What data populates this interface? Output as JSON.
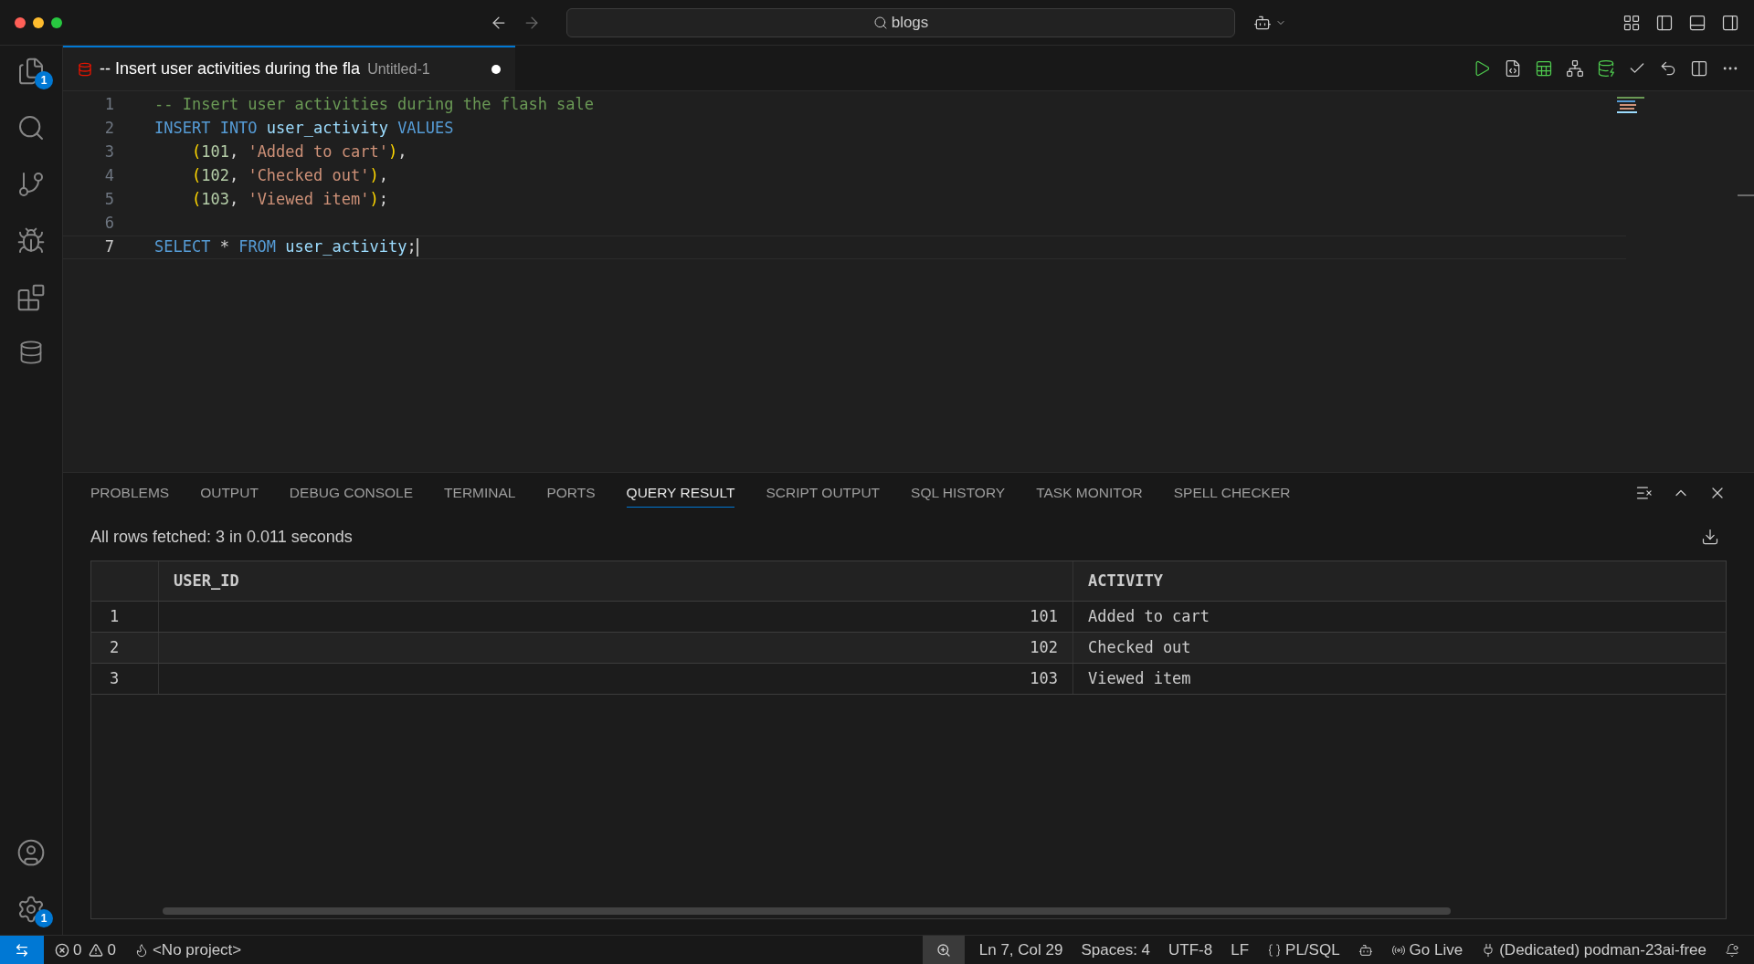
{
  "title_bar": {
    "search": "blogs"
  },
  "activity_bar": {
    "explorer_badge": "1",
    "settings_badge": "1"
  },
  "editor_tabs": [
    {
      "title": "-- Insert user activities during the fla",
      "description": "Untitled-1",
      "selected": true,
      "dirty": true
    }
  ],
  "code": [
    {
      "number": "1",
      "current": false,
      "indented": false,
      "tokens": [
        {
          "kind": "comment",
          "text": "-- Insert user activities during the flash sale"
        }
      ]
    },
    {
      "number": "2",
      "current": false,
      "indented": false,
      "tokens": [
        {
          "kind": "keyword",
          "text": "INSERT INTO "
        },
        {
          "kind": "ident",
          "text": "user_activity "
        },
        {
          "kind": "keyword",
          "text": "VALUES"
        }
      ]
    },
    {
      "number": "3",
      "current": false,
      "indented": true,
      "tokens": [
        {
          "kind": "bracket",
          "text": "("
        },
        {
          "kind": "number",
          "text": "101"
        },
        {
          "kind": "punct",
          "text": ", "
        },
        {
          "kind": "string",
          "text": "'Added to cart'"
        },
        {
          "kind": "bracket",
          "text": ")"
        },
        {
          "kind": "punct",
          "text": ","
        }
      ]
    },
    {
      "number": "4",
      "current": false,
      "indented": true,
      "tokens": [
        {
          "kind": "bracket",
          "text": "("
        },
        {
          "kind": "number",
          "text": "102"
        },
        {
          "kind": "punct",
          "text": ", "
        },
        {
          "kind": "string",
          "text": "'Checked out'"
        },
        {
          "kind": "bracket",
          "text": ")"
        },
        {
          "kind": "punct",
          "text": ","
        }
      ]
    },
    {
      "number": "5",
      "current": false,
      "indented": true,
      "tokens": [
        {
          "kind": "bracket",
          "text": "("
        },
        {
          "kind": "number",
          "text": "103"
        },
        {
          "kind": "punct",
          "text": ", "
        },
        {
          "kind": "string",
          "text": "'Viewed item'"
        },
        {
          "kind": "bracket",
          "text": ")"
        },
        {
          "kind": "punct",
          "text": ";"
        }
      ]
    },
    {
      "number": "6",
      "current": false
    },
    {
      "number": "7",
      "current": true,
      "indented": false,
      "tokens": [
        {
          "kind": "keyword",
          "text": "SELECT "
        },
        {
          "kind": "punct",
          "text": "* "
        },
        {
          "kind": "keyword",
          "text": "FROM "
        },
        {
          "kind": "ident",
          "text": "user_activity"
        },
        {
          "kind": "punct",
          "text": ";"
        }
      ]
    }
  ],
  "panel_tabs": [
    {
      "label": "PROBLEMS",
      "selected": false
    },
    {
      "label": "OUTPUT",
      "selected": false
    },
    {
      "label": "DEBUG CONSOLE",
      "selected": false
    },
    {
      "label": "TERMINAL",
      "selected": false
    },
    {
      "label": "PORTS",
      "selected": false
    },
    {
      "label": "QUERY RESULT",
      "selected": true
    },
    {
      "label": "SCRIPT OUTPUT",
      "selected": false
    },
    {
      "label": "SQL HISTORY",
      "selected": false
    },
    {
      "label": "TASK MONITOR",
      "selected": false
    },
    {
      "label": "SPELL CHECKER",
      "selected": false
    }
  ],
  "query_result": {
    "summary": "All rows fetched: 3 in 0.011 seconds",
    "columns": [
      "USER_ID",
      "ACTIVITY"
    ],
    "rows": [
      {
        "number": "1",
        "cells": [
          "101",
          "Added to cart"
        ]
      },
      {
        "number": "2",
        "cells": [
          "102",
          "Checked out"
        ]
      },
      {
        "number": "3",
        "cells": [
          "103",
          "Viewed item"
        ]
      }
    ]
  },
  "status_bar": {
    "errors": "0",
    "warnings": "0",
    "project": "<No project>",
    "position": "Ln 7, Col 29",
    "spaces": "Spaces: 4",
    "encoding": "UTF-8",
    "eol": "LF",
    "language": "PL/SQL",
    "go_live": "Go Live",
    "connection": "(Dedicated) podman-23ai-free"
  }
}
